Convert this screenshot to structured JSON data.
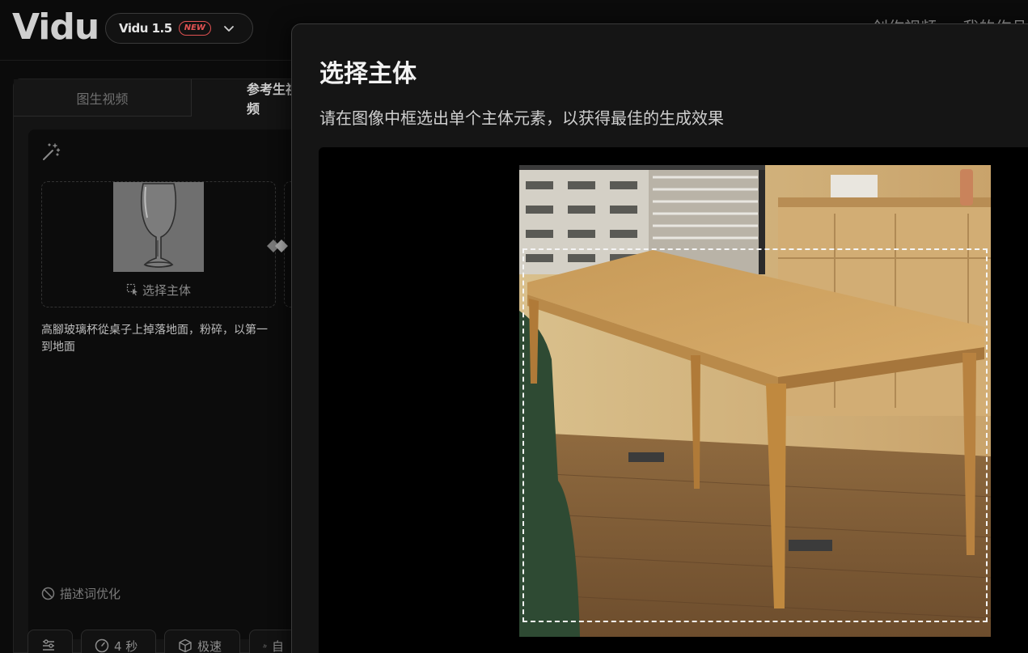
{
  "header": {
    "logo": "Vidu",
    "model": {
      "name": "Vidu 1.5",
      "badge": "NEW"
    },
    "nav": [
      "创作视频",
      "我的作品"
    ]
  },
  "panel": {
    "tabs": [
      {
        "label": "图生视频",
        "active": false
      },
      {
        "label": "参考生视频",
        "active": true
      }
    ],
    "reference": {
      "select_subject_label": "选择主体"
    },
    "prompt": [
      "高腳玻璃杯從桌子上掉落地面，粉碎，以第一",
      "到地面"
    ],
    "prompt_optimize_label": "描述词优化",
    "chips": [
      {
        "icon": "settings-icon",
        "label": ""
      },
      {
        "icon": "clock-icon",
        "label": "4 秒"
      },
      {
        "icon": "cube-icon",
        "label": "极速"
      },
      {
        "icon": "shapes-icon",
        "label": "自"
      }
    ]
  },
  "modal": {
    "title": "选择主体",
    "description": "请在图像中框选出单个主体元素，以获得最佳的生成效果"
  },
  "colors": {
    "background": "#0b0b0b",
    "panel": "#141414",
    "modal": "#151515",
    "badge": "#e05252",
    "selection": "#f5f5f5"
  }
}
